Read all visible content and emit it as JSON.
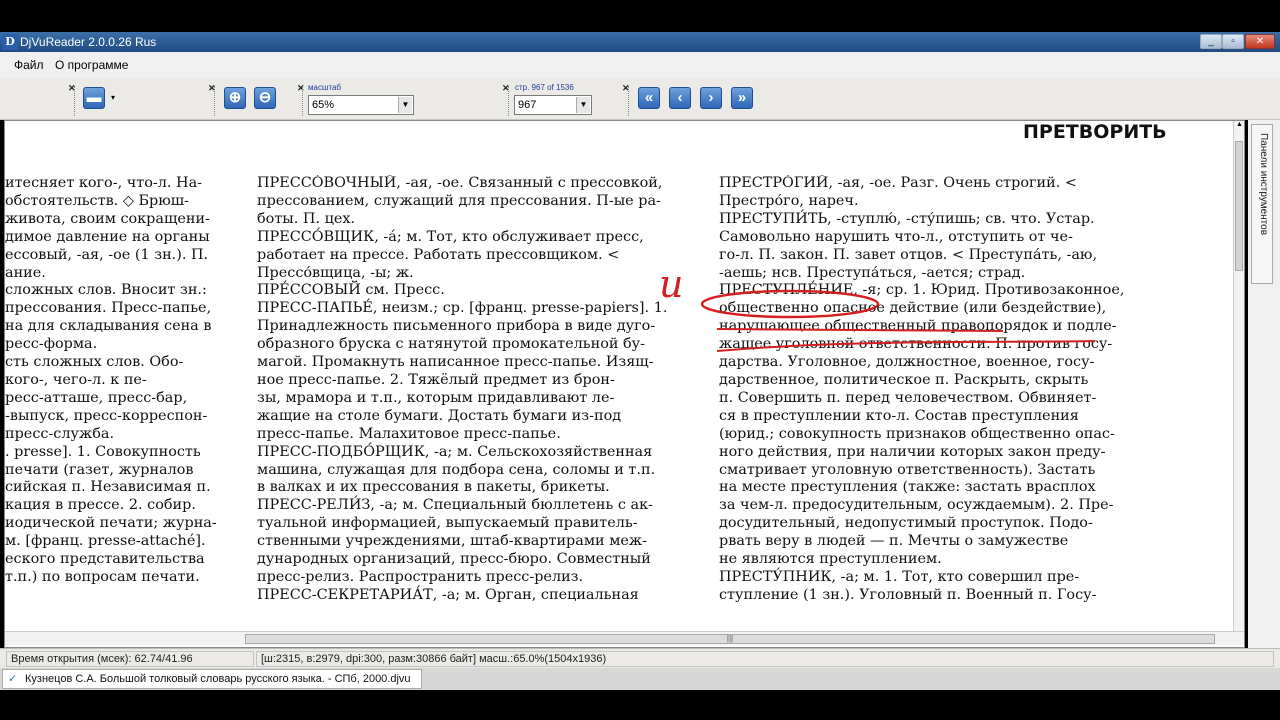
{
  "window": {
    "title": "DjVuReader 2.0.0.26 Rus",
    "icon": "djvu-app-icon"
  },
  "menu": {
    "items": [
      "Файл",
      "О программе"
    ]
  },
  "toolbar": {
    "zoom": {
      "label": "масштаб",
      "value": "65%"
    },
    "page": {
      "label": "стр. 967 of 1536",
      "value": "967"
    },
    "icons": [
      "document-icon",
      "zoom-in-icon",
      "zoom-out-icon",
      "first-page-icon",
      "prev-page-icon",
      "next-page-icon",
      "last-page-icon"
    ]
  },
  "document": {
    "headword": "ПРЕТВОРИТЬ",
    "col1": [
      "итесняет кого-, что-л. На-",
      "обстоятельств. ◇ Брюш-",
      "живота, своим сокращени-",
      "димое давление на органы",
      "ессовый, -ая, -ое (1 зн.). П.",
      "ание.",
      "сложных слов. Вносит зн.:",
      "прессования. Пресс-папье,",
      "на для складывания сена в",
      "ресс-форма.",
      "сть сложных слов. Обо-",
      "кого-, чего-л. к пе-",
      "ресс-атташе, пресс-бар,",
      "-выпуск, пресс-корреспон-",
      "пресс-служба.",
      ". presse]. 1. Совокупность",
      "печати (газет, журналов",
      "сийская п. Независимая п.",
      "кация в прессе. 2. собир.",
      "иодической печати; журна-",
      "м. [франц. presse-attaché].",
      "еского представительства",
      "т.п.) по вопросам печати."
    ],
    "col2": [
      "ПРЕССО́ВОЧНЫЙ, -ая, -ое. Связанный с прессовкой,",
      "прессованием, служащий для прессования. П-ые ра-",
      "боты. П. цех.",
      "ПРЕССО́ВЩИК, -á; м. Тот, кто обслуживает пресс,",
      "работает на прессе. Работать прессовщиком. <",
      "Прессо́вщица, -ы; ж.",
      "ПРЕ́ССОВЫЙ см. Пресс.",
      "ПРЕСС-ПАПЬЕ́, неизм.; ср. [франц. presse-papiers]. 1.",
      "Принадлежность письменного прибора в виде дуго-",
      "образного бруска с натянутой промокательной бу-",
      "магой. Промакнуть написанное пресс-папье. Изящ-",
      "ное пресс-папье. 2. Тяжёлый предмет из брон-",
      "зы, мрамора и т.п., которым придавливают ле-",
      "жащие на столе бумаги. Достать бумаги из-под",
      "пресс-папье. Малахитовое пресс-папье.",
      "ПРЕСС-ПОДБО́РЩИК, -а; м. Сельскохозяйственная",
      "машина, служащая для подбора сена, соломы и т.п.",
      "в валках и их прессования в пакеты, брикеты.",
      "ПРЕСС-РЕЛИ́З, -а; м. Специальный бюллетень с ак-",
      "туальной информацией, выпускаемый правитель-",
      "ственными учреждениями, штаб-квартирами меж-",
      "дународных организаций, пресс-бюро. Совместный",
      "пресс-релиз. Распространить пресс-релиз.",
      "ПРЕСС-СЕКРЕТАРИА́Т, -а; м. Орган, специальная"
    ],
    "col3": [
      "ПРЕСТРО́ГИЙ, -ая, -ое. Разг. Очень строгий. <",
      "Престро́го, нареч.",
      "ПРЕСТУПИ́ТЬ, -ступлю́, -сту́пишь; св. что. Устар.",
      "Самовольно нарушить что-л., отступить от че-",
      "го-л. П. закон. П. завет отцов. < Преступа́ть, -аю,",
      "-аешь; нсв. Преступа́ться, -ается; страд.",
      "ПРЕСТУПЛЕ́НИЕ, -я; ср. 1. Юрид. Противозаконное,",
      "общественно опасное действие (или бездействие),",
      "нарушающее общественный правопорядок и подле-",
      "жащее уголовной ответственности. П. против госу-",
      "дарства. Уголовное, должностное, военное, госу-",
      "дарственное, политическое п. Раскрыть, скрыть",
      "п. Совершить п. перед человечеством. Обвиняет-",
      "ся в преступлении кто-л. Состав преступления",
      "(юрид.; совокупность признаков общественно опас-",
      "ного действия, при наличии которых закон преду-",
      "сматривает уголовную ответственность). Застать",
      "на месте преступления (также: застать врасплох",
      "за чем-л. предосудительным, осуждаемым). 2. Пре-",
      "досудительный, недопустимый проступок. Подо-",
      "рвать веру в людей — п. Мечты о замужестве",
      "не являются преступлением.",
      "ПРЕСТУ́ПНИК, -а; м. 1. Тот, кто совершил пре-",
      "ступление (1 зн.). Уголовный п. Военный п. Госу-"
    ],
    "annotation": {
      "handwritten_letter": "и",
      "color": "#d42020"
    }
  },
  "side_panel": {
    "label": "Панели инструментов"
  },
  "status": {
    "open_time": "Время открытия (мсек): 62.74/41.96",
    "info": "[ш:2315, в:2979, dpi:300, разм:30866 байт] масш.:65.0%(1504x1936)"
  },
  "taskbar": {
    "document": "Кузнецов С.А. Большой толковый словарь русского языка. - СПб, 2000.djvu"
  }
}
